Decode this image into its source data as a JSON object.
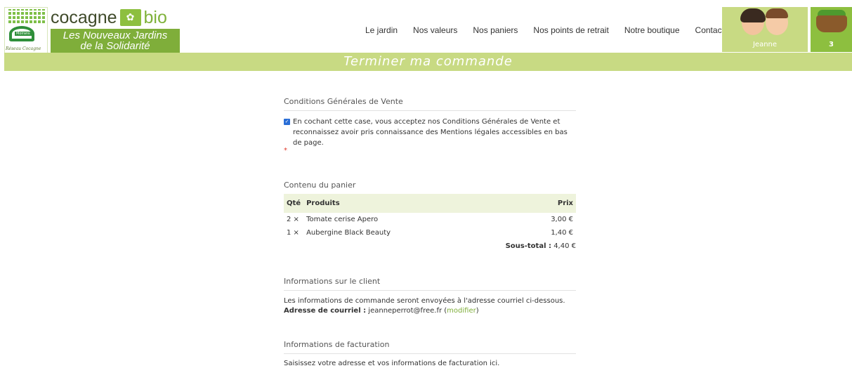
{
  "header": {
    "brand": {
      "cocagne": "cocagne",
      "bio": "bio",
      "line1": "Les Nouveaux Jardins",
      "line2": "de la Solidarité",
      "reseau": "Réseau Cocagne",
      "can_label": "Moirans"
    },
    "nav": [
      "Le jardin",
      "Nos valeurs",
      "Nos paniers",
      "Nos points de retrait",
      "Notre boutique",
      "Contact"
    ],
    "user": {
      "name": "Jeanne"
    },
    "cart": {
      "count": "3"
    }
  },
  "banner": {
    "title": "Terminer ma commande"
  },
  "cgv": {
    "title": "Conditions Générales de Vente",
    "checkbox_checked": true,
    "text": "En cochant cette case, vous acceptez nos Conditions Générales de Vente et reconnaissez avoir pris connaissance des Mentions légales accessibles en bas de page.",
    "required_mark": "*"
  },
  "cart_section": {
    "title": "Contenu du panier",
    "headers": {
      "qty": "Qté",
      "products": "Produits",
      "price": "Prix"
    },
    "rows": [
      {
        "qty": "2 ×",
        "product": "Tomate cerise Apero",
        "price": "3,00 €"
      },
      {
        "qty": "1 ×",
        "product": "Aubergine Black Beauty",
        "price": "1,40 €"
      }
    ],
    "subtotal_label": "Sous-total :",
    "subtotal_value": "4,40 €"
  },
  "client": {
    "title": "Informations sur le client",
    "text": "Les informations de commande seront envoyées à l'adresse courriel ci-dessous.",
    "email_label": "Adresse de courriel :",
    "email": "jeanneperrot@free.fr",
    "modify_open": "(",
    "modify": "modifier",
    "modify_close": ")"
  },
  "billing": {
    "title": "Informations de facturation",
    "text": "Saisissez votre adresse et vos informations de facturation ici."
  },
  "colors": {
    "accent": "#7fae3a",
    "banner": "#c8da83",
    "cart_bg": "#8dbf3f"
  }
}
